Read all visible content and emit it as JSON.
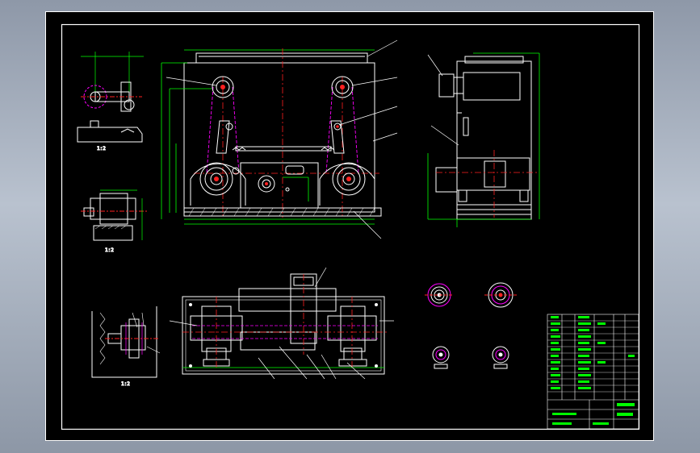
{
  "viewer": {
    "background": "#9aa4b4",
    "sheet_color": "#000000"
  },
  "drawing": {
    "palette": {
      "frame": "#ffffff",
      "part": "#ffffff",
      "dimension": "#00ff00",
      "centerline": "#ff2020",
      "hidden": "#ff00ff",
      "leader": "#ffffff",
      "note": "#ffff00"
    },
    "views": [
      {
        "id": "front-elevation",
        "kind": "main view"
      },
      {
        "id": "side-elevation",
        "kind": "side view"
      },
      {
        "id": "plan-view",
        "kind": "top view"
      },
      {
        "id": "detail-a",
        "kind": "detail"
      },
      {
        "id": "detail-b",
        "kind": "detail"
      },
      {
        "id": "detail-c",
        "kind": "detail"
      },
      {
        "id": "section-1",
        "kind": "section"
      },
      {
        "id": "section-2",
        "kind": "section"
      },
      {
        "id": "section-3",
        "kind": "section"
      },
      {
        "id": "section-4",
        "kind": "section"
      }
    ],
    "detail_scale_labels": [
      "1:2",
      "1:2",
      "1:2"
    ],
    "title_block": {
      "icon": "title-block-table"
    }
  }
}
